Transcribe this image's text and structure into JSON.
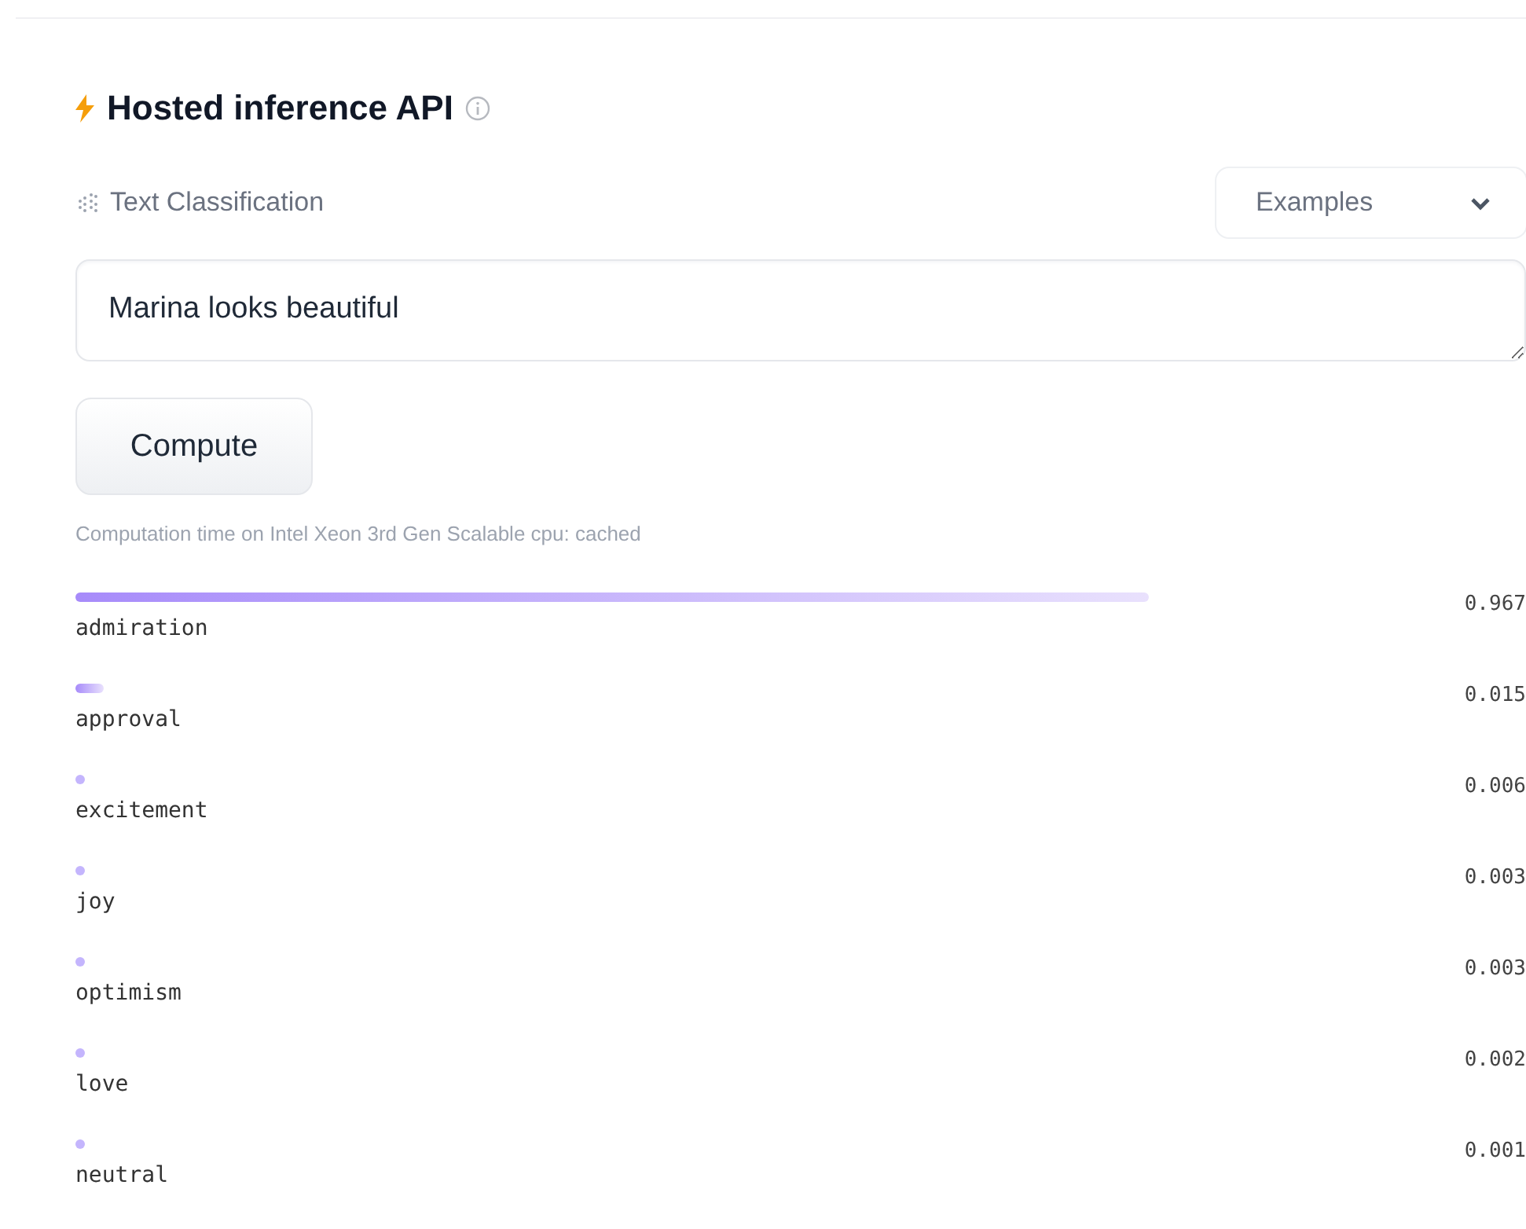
{
  "title": "Hosted inference API",
  "task": "Text Classification",
  "examples_button": "Examples",
  "input": {
    "value": "Marina looks beautiful"
  },
  "compute_button": "Compute",
  "computation_note": "Computation time on Intel Xeon 3rd Gen Scalable cpu: cached",
  "results": [
    {
      "label": "admiration",
      "score": "0.967"
    },
    {
      "label": "approval",
      "score": "0.015"
    },
    {
      "label": "excitement",
      "score": "0.006"
    },
    {
      "label": "joy",
      "score": "0.003"
    },
    {
      "label": "optimism",
      "score": "0.003"
    },
    {
      "label": "love",
      "score": "0.002"
    },
    {
      "label": "neutral",
      "score": "0.001"
    }
  ]
}
